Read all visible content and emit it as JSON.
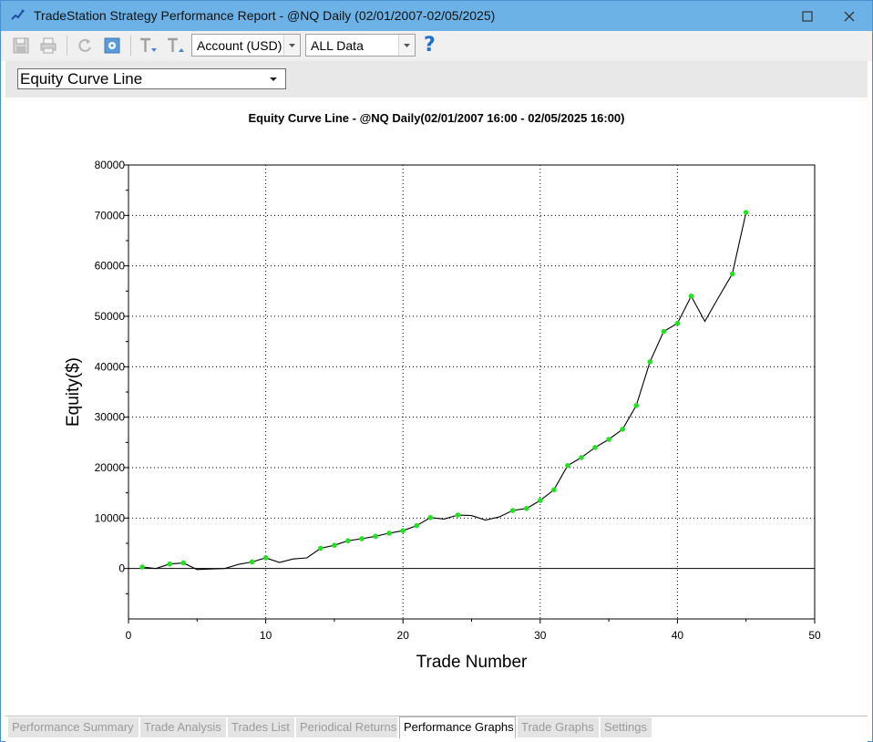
{
  "window": {
    "title": "TradeStation Strategy Performance Report - @NQ Daily (02/01/2007-02/05/2025)",
    "title_bar_color": "#6cb2e6"
  },
  "toolbar": {
    "account_combo": "Account (USD)",
    "range_combo": "ALL Data",
    "help": "?",
    "icons": [
      "save-icon",
      "print-icon",
      "refresh-icon",
      "settings-icon",
      "text-decrease-icon",
      "text-increase-icon",
      "help-icon"
    ]
  },
  "graph_selector": {
    "value": "Equity Curve Line"
  },
  "chart_data": {
    "type": "line",
    "title": "Equity Curve Line - @NQ Daily(02/01/2007 16:00 - 02/05/2025 16:00)",
    "xlabel": "Trade Number",
    "ylabel": "Equity($)",
    "xlim": [
      0,
      50
    ],
    "ylim": [
      -10000,
      80000
    ],
    "x_ticks": [
      "0",
      "10",
      "20",
      "30",
      "40",
      "50"
    ],
    "y_ticks": [
      "0",
      "10000",
      "20000",
      "30000",
      "40000",
      "50000",
      "60000",
      "70000",
      "80000"
    ],
    "grid": "dotted",
    "line_color": "#000000",
    "marker_color": "#22e022",
    "series": [
      {
        "x": [
          1,
          2,
          3,
          4,
          5,
          6,
          7,
          8,
          9,
          10,
          11,
          12,
          13,
          14,
          15,
          16,
          17,
          18,
          19,
          20,
          21,
          22,
          23,
          24,
          25,
          26,
          27,
          28,
          29,
          30,
          31,
          32,
          33,
          34,
          35,
          36,
          37,
          38,
          39,
          40,
          41,
          42,
          43,
          44,
          45
        ],
        "y": [
          300,
          0,
          900,
          1100,
          -200,
          -100,
          0,
          800,
          1300,
          2100,
          1200,
          1900,
          2100,
          4000,
          4600,
          5500,
          5900,
          6400,
          7000,
          7500,
          8500,
          10100,
          9800,
          10600,
          10500,
          9600,
          10200,
          11500,
          11900,
          13500,
          15600,
          20400,
          22000,
          24000,
          25600,
          27600,
          32300,
          41000,
          47000,
          48600,
          54000,
          49000,
          53800,
          58400,
          70600
        ],
        "marker": [
          true,
          false,
          true,
          true,
          false,
          false,
          false,
          false,
          true,
          true,
          false,
          false,
          false,
          true,
          true,
          true,
          true,
          true,
          true,
          true,
          true,
          true,
          false,
          true,
          false,
          false,
          false,
          true,
          true,
          true,
          true,
          true,
          true,
          true,
          true,
          true,
          true,
          true,
          true,
          true,
          true,
          false,
          false,
          true,
          true
        ]
      }
    ]
  },
  "tabs": [
    {
      "label": "Performance Summary",
      "active": false
    },
    {
      "label": "Trade Analysis",
      "active": false
    },
    {
      "label": "Trades List",
      "active": false
    },
    {
      "label": "Periodical Returns",
      "active": false
    },
    {
      "label": "Performance Graphs",
      "active": true
    },
    {
      "label": "Trade Graphs",
      "active": false
    },
    {
      "label": "Settings",
      "active": false
    }
  ]
}
